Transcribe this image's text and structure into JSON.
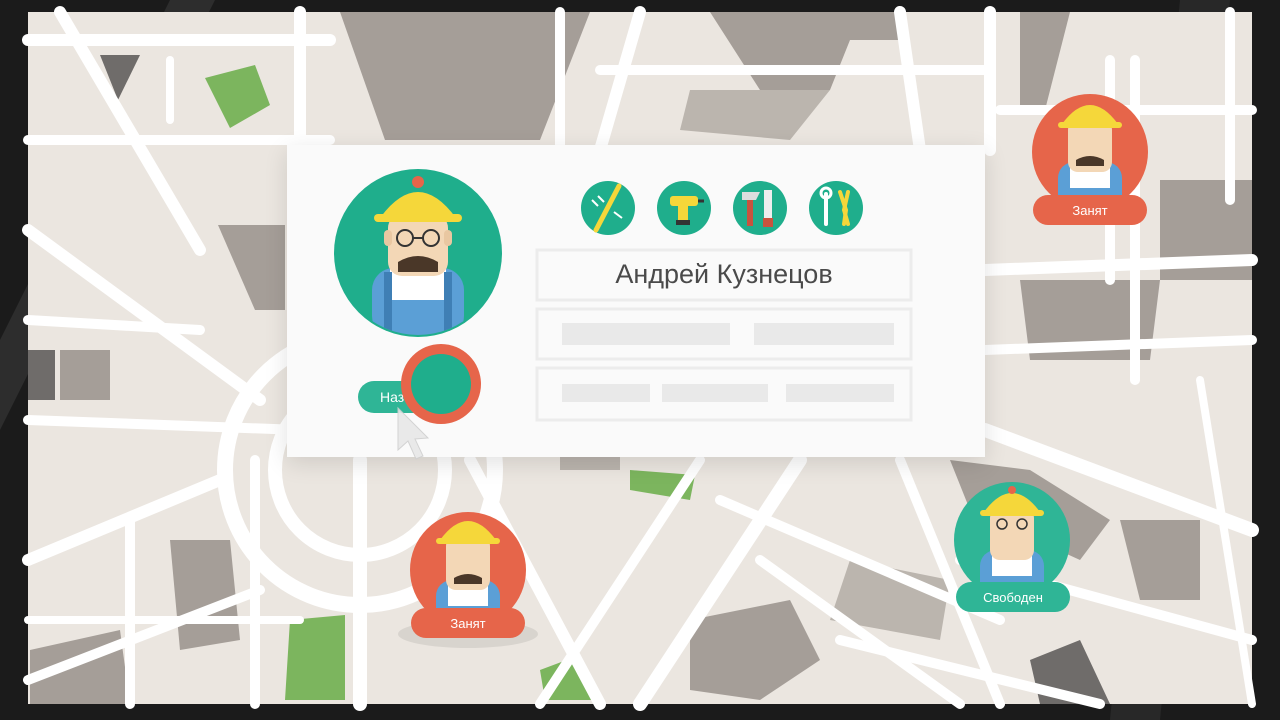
{
  "profile": {
    "name": "Андрей Кузнецов",
    "assign_button_label": "Наз"
  },
  "tools": [
    {
      "icon": "screwdriver-icon"
    },
    {
      "icon": "drill-icon"
    },
    {
      "icon": "axe-saw-icon"
    },
    {
      "icon": "wrench-pliers-icon"
    }
  ],
  "workers": [
    {
      "status": "Занят",
      "state": "busy"
    },
    {
      "status": "Занят",
      "state": "busy"
    },
    {
      "status": "Свободен",
      "state": "free"
    }
  ],
  "colors": {
    "map_background": "#ebe6e0",
    "road": "#ffffff",
    "park": "#7cb55e",
    "block": "#a59e98",
    "accent_teal": "#1fae8c",
    "accent_orange": "#e6654a",
    "helmet": "#f5d73a",
    "overalls": "#5b9fd6"
  }
}
